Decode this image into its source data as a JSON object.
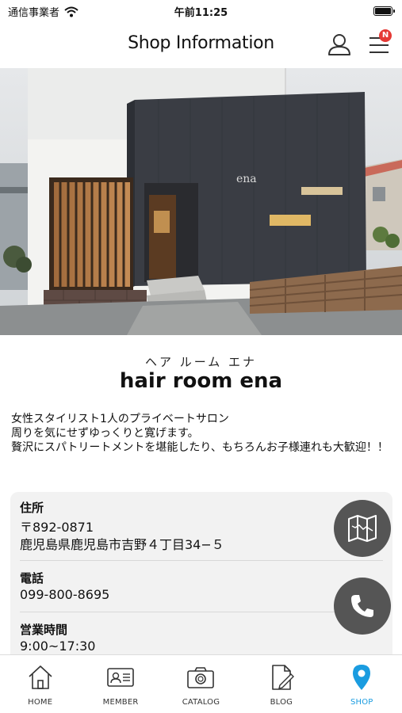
{
  "status_bar": {
    "carrier": "通信事業者",
    "time": "午前11:25"
  },
  "nav": {
    "title": "Shop Information",
    "notification_badge": "N"
  },
  "shop": {
    "name_kana": "ヘア ルーム エナ",
    "name": "hair room ena",
    "description": "女性スタイリスト1人のプライベートサロン\n周りを気にせずゆっくりと寛げます。\n贅沢にスパトリートメントを堪能したり、もちろんお子様連れも大歓迎！！",
    "signage": "ena"
  },
  "info": {
    "address_label": "住所",
    "postal_code": "〒892-0871",
    "address": "鹿児島県鹿児島市吉野４丁目34−５",
    "phone_label": "電話",
    "phone": "099-800-8695",
    "hours_label": "営業時間",
    "hours": "9:00~17:30"
  },
  "tabs": [
    {
      "label": "HOME",
      "icon": "house-icon",
      "active": false
    },
    {
      "label": "MEMBER",
      "icon": "member-card-icon",
      "active": false
    },
    {
      "label": "CATALOG",
      "icon": "camera-icon",
      "active": false
    },
    {
      "label": "BLOG",
      "icon": "blog-pen-icon",
      "active": false
    },
    {
      "label": "SHOP",
      "icon": "location-pin-icon",
      "active": true
    }
  ],
  "colors": {
    "accent": "#1a9ce0",
    "badge": "#e53935",
    "fab": "#555555",
    "card": "#f2f2f2"
  }
}
